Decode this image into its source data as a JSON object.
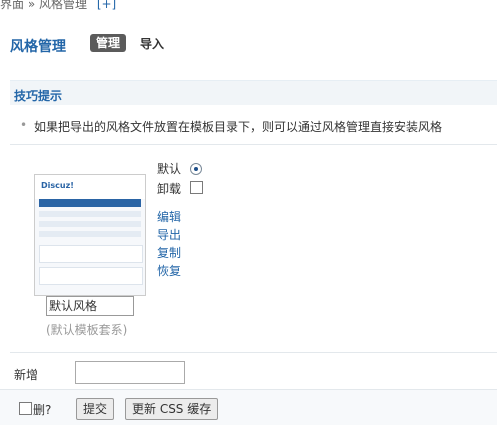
{
  "breadcrumb": {
    "text": "界面 » 风格管理",
    "add_link": "[+]"
  },
  "header": {
    "title": "风格管理",
    "tabs": [
      {
        "label": "管理",
        "active": true
      },
      {
        "label": "导入",
        "active": false
      }
    ]
  },
  "tips": {
    "title": "技巧提示",
    "items": [
      "如果把导出的风格文件放置在模板目录下，则可以通过风格管理直接安装风格"
    ]
  },
  "style_item": {
    "thumbnail_text": "Discuz!",
    "name_value": "默认风格",
    "template_note": "(默认模板套系)",
    "default_label": "默认",
    "default_checked": true,
    "unload_label": "卸载",
    "unload_checked": false,
    "actions": [
      "编辑",
      "导出",
      "复制",
      "恢复"
    ]
  },
  "new_row": {
    "label": "新增",
    "value": ""
  },
  "footer": {
    "delete_label": "删?",
    "submit_label": "提交",
    "refresh_label": "更新 CSS 缓存"
  },
  "colors": {
    "link": "#2366a8",
    "tab_active_bg": "#5b5b5b",
    "tips_bg": "#f1f5f8"
  }
}
